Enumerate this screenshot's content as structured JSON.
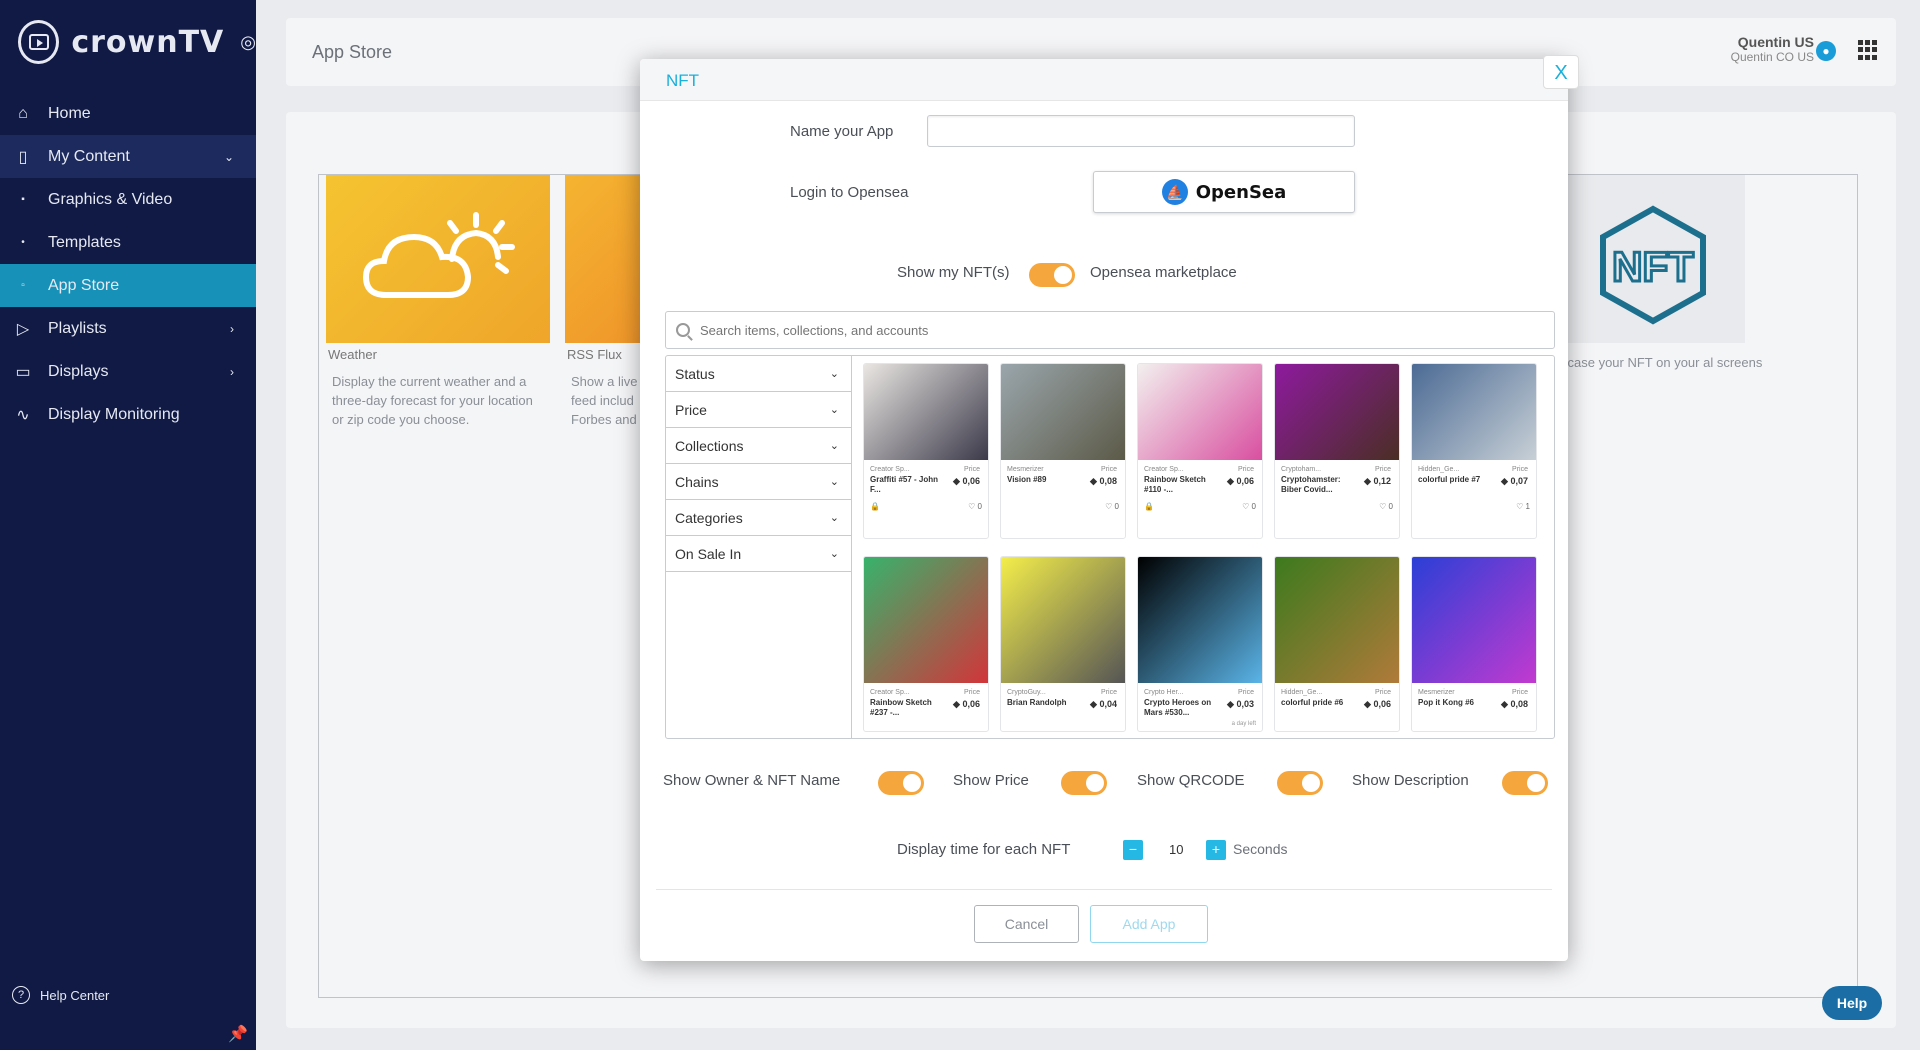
{
  "brand": {
    "name": "crownTV"
  },
  "sidebar": {
    "items": [
      {
        "label": "Home",
        "icon": "home-icon"
      },
      {
        "label": "My Content",
        "icon": "document-icon"
      },
      {
        "label": "Graphics & Video",
        "icon": "dot-icon"
      },
      {
        "label": "Templates",
        "icon": "dot-icon"
      },
      {
        "label": "App Store",
        "icon": "dot-icon"
      },
      {
        "label": "Playlists",
        "icon": "play-icon"
      },
      {
        "label": "Displays",
        "icon": "tv-icon"
      },
      {
        "label": "Display Monitoring",
        "icon": "pulse-icon"
      }
    ],
    "help_center": "Help Center"
  },
  "header": {
    "title": "App Store",
    "user_name": "Quentin US",
    "user_org": "Quentin CO US"
  },
  "apps": [
    {
      "name": "Weather",
      "description": "Display the current weather and a three-day forecast for your location or zip code you choose."
    },
    {
      "name": "RSS Flux",
      "description": "Show a live feed includ Forbes and"
    },
    {
      "name": "NFT",
      "description": "vcase your NFT on your al screens"
    }
  ],
  "modal": {
    "title": "NFT",
    "close_label": "X",
    "name_label": "Name your App",
    "name_value": "",
    "login_label": "Login to Opensea",
    "opensea_label": "OpenSea",
    "toggle_left": "Show my NFT(s)",
    "toggle_right": "Opensea marketplace",
    "search_placeholder": "Search items, collections, and accounts",
    "filters": [
      "Status",
      "Price",
      "Collections",
      "Chains",
      "Categories",
      "On Sale In"
    ],
    "price_label": "Price",
    "nfts": [
      {
        "collection": "Creator Sp...",
        "name": "Graffiti #57 - John F...",
        "price": "0,06",
        "likes": "0",
        "locked": true,
        "colors": [
          "#e9e6e2",
          "#3c3a4a"
        ]
      },
      {
        "collection": "Mesmerizer",
        "name": "Vision #89",
        "price": "0,08",
        "likes": "0",
        "locked": false,
        "colors": [
          "#9aa6ac",
          "#5c5a48"
        ]
      },
      {
        "collection": "Creator Sp...",
        "name": "Rainbow Sketch #110 -...",
        "price": "0,06",
        "likes": "0",
        "locked": true,
        "colors": [
          "#f2f0ee",
          "#d94fa0"
        ]
      },
      {
        "collection": "Cryptoham...",
        "name": "Cryptohamster: Biber Covid...",
        "price": "0,12",
        "likes": "0",
        "locked": false,
        "colors": [
          "#8e1a9e",
          "#4a2e24"
        ]
      },
      {
        "collection": "Hidden_Ge...",
        "name": "colorful pride #7",
        "price": "0,07",
        "likes": "1",
        "locked": false,
        "colors": [
          "#4b6a94",
          "#c8d0d6"
        ]
      },
      {
        "collection": "Creator Sp...",
        "name": "Rainbow Sketch #237 -...",
        "price": "0,06",
        "likes": "",
        "locked": false,
        "colors": [
          "#37b36c",
          "#d2353a"
        ]
      },
      {
        "collection": "CryptoGuy...",
        "name": "Brian Randolph",
        "price": "0,04",
        "likes": "",
        "locked": false,
        "colors": [
          "#f4ee4a",
          "#555555"
        ]
      },
      {
        "collection": "Crypto Her...",
        "name": "Crypto Heroes on Mars #530...",
        "price": "0,03",
        "likes": "",
        "locked": false,
        "extra": "a day left",
        "colors": [
          "#000000",
          "#5ab4e8"
        ]
      },
      {
        "collection": "Hidden_Ge...",
        "name": "colorful pride #6",
        "price": "0,06",
        "likes": "",
        "locked": false,
        "colors": [
          "#3c7a1e",
          "#b07a3a"
        ]
      },
      {
        "collection": "Mesmerizer",
        "name": "Pop it Kong #6",
        "price": "0,08",
        "likes": "",
        "locked": false,
        "colors": [
          "#2a3fd6",
          "#c23ad0"
        ]
      }
    ],
    "options": [
      "Show Owner & NFT Name",
      "Show Price",
      "Show QRCODE",
      "Show Description"
    ],
    "time_label": "Display time for each NFT",
    "time_value": "10",
    "time_unit": "Seconds",
    "cancel_label": "Cancel",
    "add_label": "Add App"
  },
  "help_button": "Help",
  "colors": {
    "accent": "#1ab0dc",
    "toggle": "#f5a63c",
    "sidebar": "#101a44",
    "selected": "#1791b8"
  }
}
